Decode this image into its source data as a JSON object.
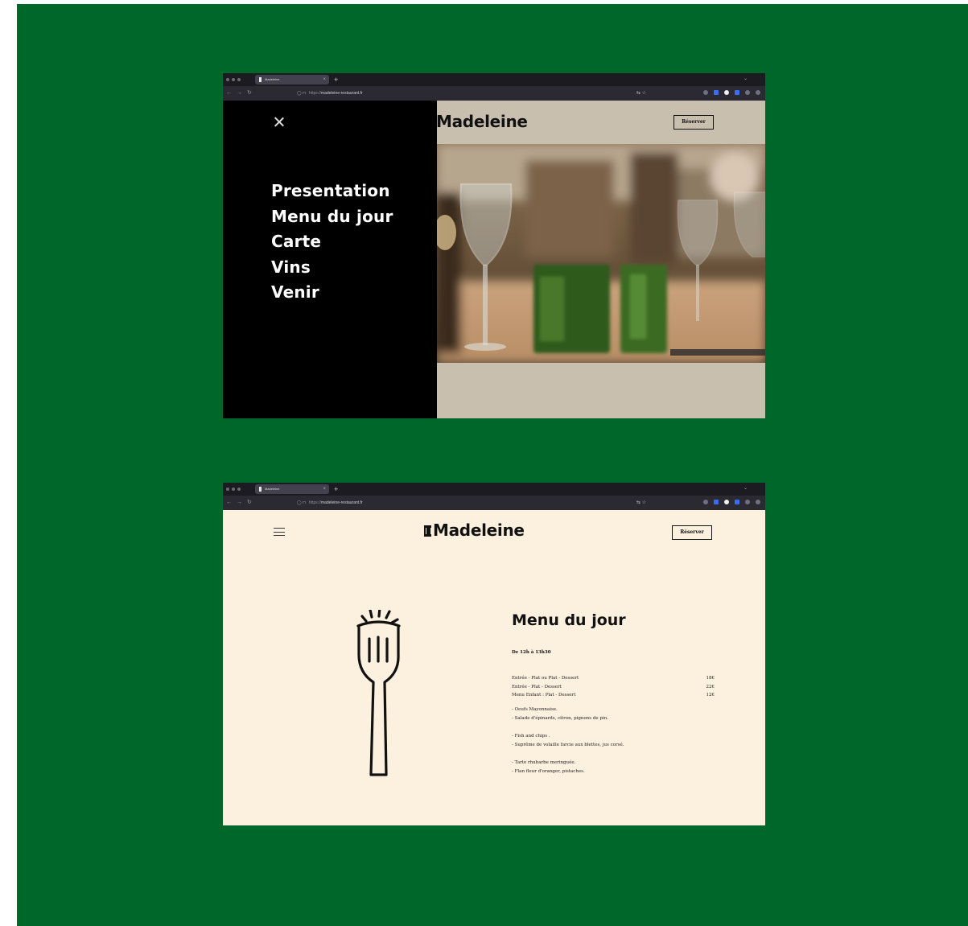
{
  "browser": {
    "tab_title": "Madeleine",
    "new_tab": "+",
    "url_protocol": "https://",
    "url_host": "madeleine-restaurant.fr"
  },
  "menu_screen": {
    "close_label": "×",
    "brand": "Madeleine",
    "reserve_label": "Réserver",
    "nav_items": [
      "Presentation",
      "Menu du jour",
      "Carte",
      "Vins",
      "Venir"
    ]
  },
  "menu_du_jour_screen": {
    "brand": "Madeleine",
    "reserve_label": "Réserver",
    "title": "Menu du jour",
    "hours": "De 12h à 13h30",
    "prices": [
      {
        "label": "Entrée - Plat ou Plat - Dessert",
        "price": "18€"
      },
      {
        "label": "Entrée - Plat - Dessert",
        "price": "22€"
      },
      {
        "label": "Menu Enfant : Plat - Dessert",
        "price": "12€"
      }
    ],
    "dishes": [
      [
        "- Oeufs Mayonnaise.",
        "- Salade d'épinards, citron, pignons de pin."
      ],
      [
        "- Fish and chips .",
        "- Suprême de volaille farcie aux blettes, jus corsé."
      ],
      [
        "- Tarte rhubarbe meringuée.",
        "- Flan fleur d'oranger, pistaches."
      ]
    ]
  },
  "colors": {
    "background_green": "#00672a",
    "menu_panel": "#000000",
    "header_beige": "#c9bfaf",
    "page_cream": "#fcf0df"
  }
}
